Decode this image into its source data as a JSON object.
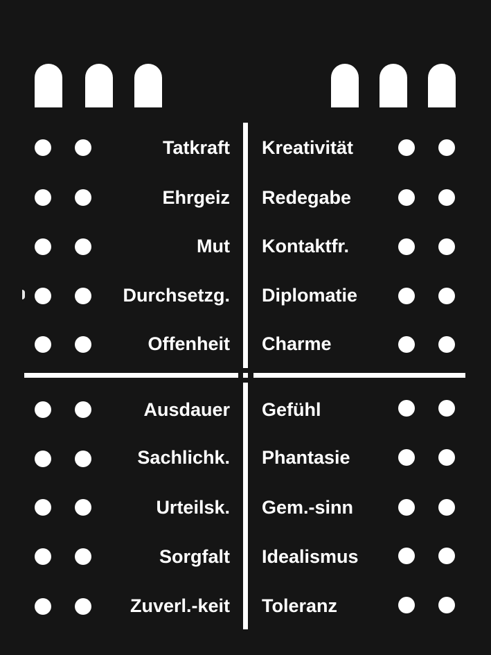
{
  "colors": {
    "background": "#151515",
    "foreground": "#ffffff"
  },
  "top_group": {
    "left_labels": [
      "Tatkraft",
      "Ehrgeiz",
      "Mut",
      "Durchsetzg.",
      "Offenheit"
    ],
    "right_labels": [
      "Kreativität",
      "Redegabe",
      "Kontaktfr.",
      "Diplomatie",
      "Charme"
    ]
  },
  "bottom_group": {
    "left_labels": [
      "Ausdauer",
      "Sachlichk.",
      "Urteilsk.",
      "Sorgfalt",
      "Zuverl.-keit"
    ],
    "right_labels": [
      "Gefühl",
      "Phantasie",
      "Gem.-sinn",
      "Idealismus",
      "Toleranz"
    ]
  }
}
